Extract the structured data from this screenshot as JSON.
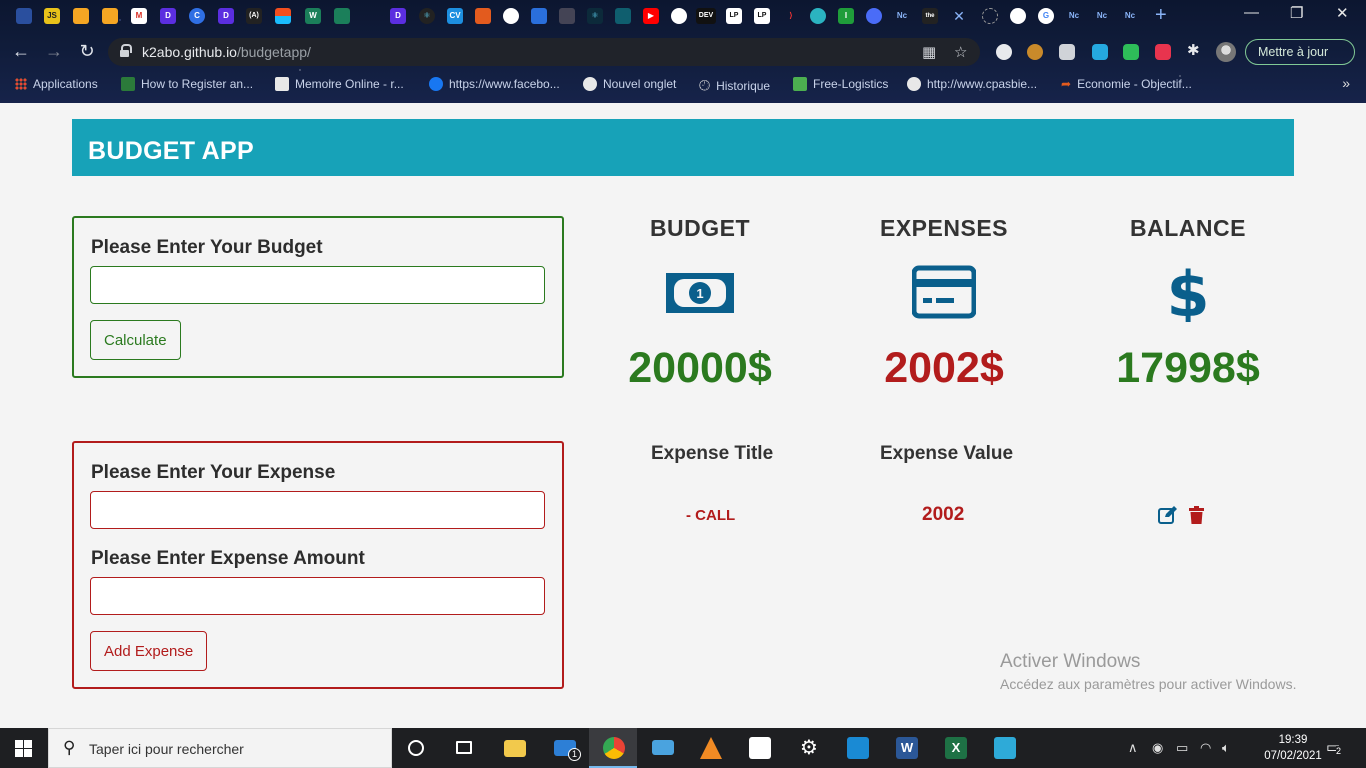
{
  "browser": {
    "tab_favicons": [
      "JS",
      "",
      "",
      "M",
      "D",
      "C",
      "D",
      "(A)",
      "",
      "W",
      "",
      "",
      "D",
      "",
      "CV",
      "",
      "",
      "",
      "",
      "",
      "",
      "",
      "DEV",
      "LP",
      "LP",
      "",
      "",
      "",
      "I",
      "",
      "Nc",
      "",
      "",
      "",
      "",
      "",
      "Nc",
      "Nc",
      "Nc"
    ],
    "url_domain": "k2abo.github.io",
    "url_path": "/budgetapp/",
    "update_button": "Mettre à jour",
    "bookmarks": [
      "Applications",
      "How to Register an...",
      "Memoire Online - r...",
      "https://www.facebo...",
      "Nouvel onglet",
      "Historique",
      "Free-Logistics",
      "http://www.cpasbie...",
      "Economie - Objectif..."
    ],
    "bookmarks_more": "»"
  },
  "app": {
    "title": "BUDGET APP",
    "budget_form": {
      "label": "Please Enter Your Budget",
      "input_value": "",
      "button": "Calculate"
    },
    "expense_form": {
      "title_label": "Please Enter Your Expense",
      "title_value": "",
      "amount_label": "Please Enter Expense Amount",
      "amount_value": "",
      "button": "Add Expense"
    },
    "stats": {
      "budget": {
        "title": "BUDGET",
        "value": "20000$",
        "icon": "money-bill-icon"
      },
      "expenses": {
        "title": "EXPENSES",
        "value": "2002$",
        "icon": "credit-card-icon"
      },
      "balance": {
        "title": "BALANCE",
        "value": "17998$",
        "icon": "dollar-sign-icon"
      }
    },
    "expense_list": {
      "headers": {
        "title": "Expense Title",
        "value": "Expense Value"
      },
      "rows": [
        {
          "title": "- CALL",
          "value": "2002"
        }
      ]
    },
    "colors": {
      "header": "#17a2b8",
      "green": "#2b7a1f",
      "red": "#b21c1c",
      "icon_blue": "#0a5f8c"
    }
  },
  "watermark": {
    "title": "Activer Windows",
    "subtitle": "Accédez aux paramètres pour activer Windows."
  },
  "taskbar": {
    "search_placeholder": "Taper ici pour rechercher",
    "time": "19:39",
    "date": "07/02/2021",
    "mail_badge": "1",
    "notification_count": "2"
  }
}
